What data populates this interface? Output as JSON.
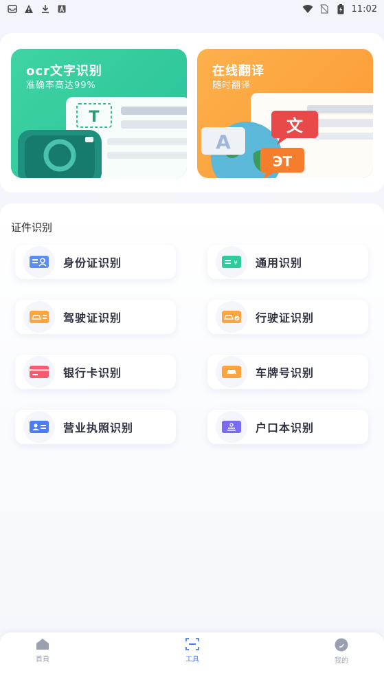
{
  "status_bar": {
    "time": "11:02",
    "left_icons": [
      "inbox-icon",
      "warning-icon",
      "download-icon",
      "font-a-icon"
    ],
    "right_icons": [
      "wifi-icon",
      "no-sim-icon",
      "battery-charging-icon"
    ]
  },
  "promos": [
    {
      "title": "ocr文字识别",
      "subtitle": "准确率高达99%",
      "color": "#2fcb9e"
    },
    {
      "title": "在线翻译",
      "subtitle": "随时翻译",
      "color": "#fca440"
    }
  ],
  "section": {
    "title": "证件识别",
    "tools": [
      {
        "label": "身份证识别",
        "icon": "id-card-icon",
        "color": "#5b8ef0"
      },
      {
        "label": "通用识别",
        "icon": "general-doc-icon",
        "color": "#2fcb9e"
      },
      {
        "label": "驾驶证识别",
        "icon": "driver-license-icon",
        "color": "#fca440"
      },
      {
        "label": "行驶证识别",
        "icon": "vehicle-license-icon",
        "color": "#fca440"
      },
      {
        "label": "银行卡识别",
        "icon": "bank-card-icon",
        "color": "#f55b6f"
      },
      {
        "label": "车牌号识别",
        "icon": "license-plate-icon",
        "color": "#fca440"
      },
      {
        "label": "营业执照识别",
        "icon": "business-license-icon",
        "color": "#4d7cf0"
      },
      {
        "label": "户口本识别",
        "icon": "household-register-icon",
        "color": "#7a6cf0"
      }
    ]
  },
  "bottom_nav": {
    "items": [
      {
        "label": "首頁",
        "icon": "home-icon"
      },
      {
        "label": "工具",
        "icon": "scan-icon"
      },
      {
        "label": "我的",
        "icon": "profile-icon"
      }
    ],
    "active": "工具",
    "active_color": "#4d7cf0"
  }
}
